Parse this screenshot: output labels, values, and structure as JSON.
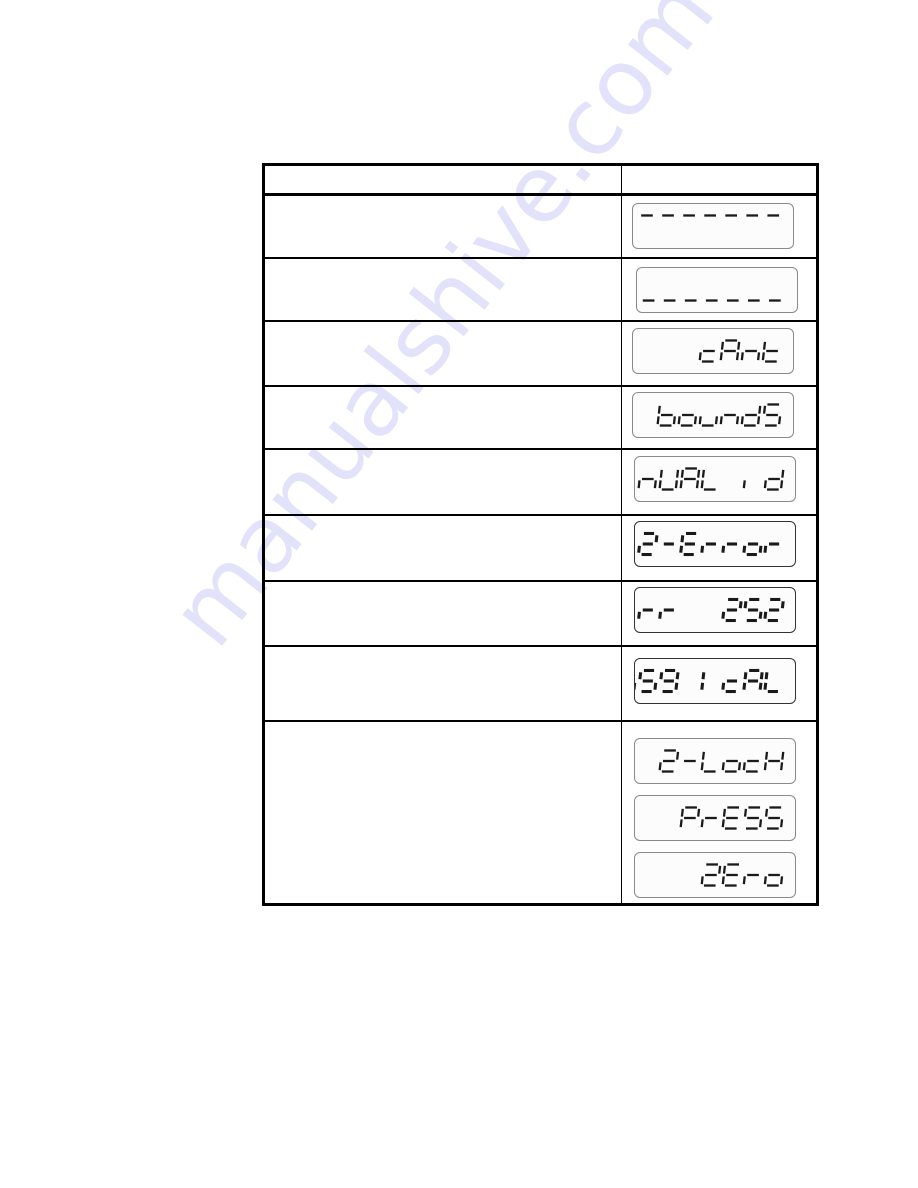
{
  "table": {
    "headers": [
      "",
      ""
    ],
    "rows": [
      {
        "description": "",
        "displays": [
          {
            "text": "‾‾‾‾‾‾‾",
            "style": "normal"
          }
        ]
      },
      {
        "description": "",
        "displays": [
          {
            "text": "_______",
            "style": "normal"
          }
        ]
      },
      {
        "description": "",
        "displays": [
          {
            "text": "cAnt",
            "style": "normal"
          }
        ]
      },
      {
        "description": "",
        "displays": [
          {
            "text": "boundS",
            "style": "normal"
          }
        ]
      },
      {
        "description": "",
        "displays": [
          {
            "text": "inUAL id",
            "style": "normal"
          }
        ]
      },
      {
        "description": "",
        "displays": [
          {
            "text": "2-Error",
            "style": "bold"
          }
        ]
      },
      {
        "description": "",
        "displays": [
          {
            "text": "Err  252",
            "style": "bold"
          }
        ]
      },
      {
        "description": "",
        "displays": [
          {
            "text": "b59 IcAL",
            "style": "bold"
          }
        ]
      },
      {
        "description": "",
        "displays": [
          {
            "text": "2-LocH",
            "style": "normal"
          },
          {
            "text": "PrESS",
            "style": "normal"
          },
          {
            "text": "2Ero",
            "style": "normal"
          }
        ]
      }
    ]
  },
  "watermark": "manualshive.com",
  "colors": {
    "segment": "#1a1a1a",
    "border": "#000000",
    "watermark": "#9696f0"
  }
}
